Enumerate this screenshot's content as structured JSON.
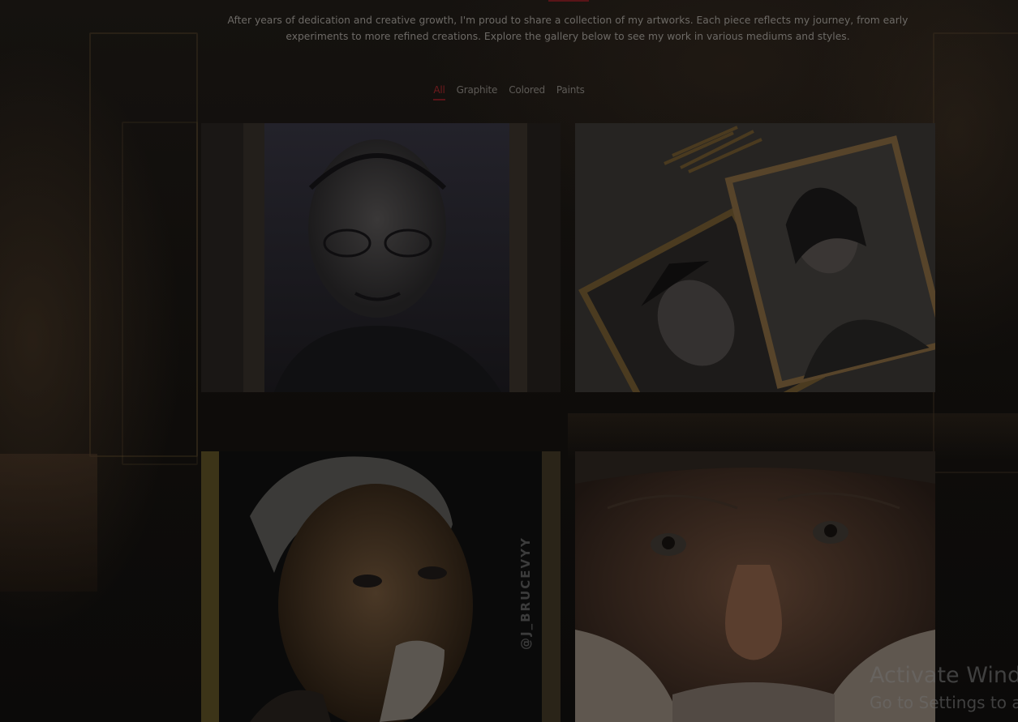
{
  "intro": {
    "line1": "After years of dedication and creative growth, I'm proud to share a collection of my artworks. Each piece reflects my journey, from early",
    "line2": "experiments to more refined creations. Explore the gallery below to see my work in various mediums and styles."
  },
  "filters": [
    {
      "label": "All",
      "active": true
    },
    {
      "label": "Graphite",
      "active": false
    },
    {
      "label": "Colored",
      "active": false
    },
    {
      "label": "Paints",
      "active": false
    }
  ],
  "gallery": {
    "artwork_signature": "@J_BRUCEVYY"
  },
  "watermark": {
    "title": "Activate Windows",
    "subtitle": "Go to Settings to activate Windows."
  },
  "colors": {
    "accent": "#5a1418",
    "text": "#6d6a66",
    "background": "#0d0c0b"
  }
}
